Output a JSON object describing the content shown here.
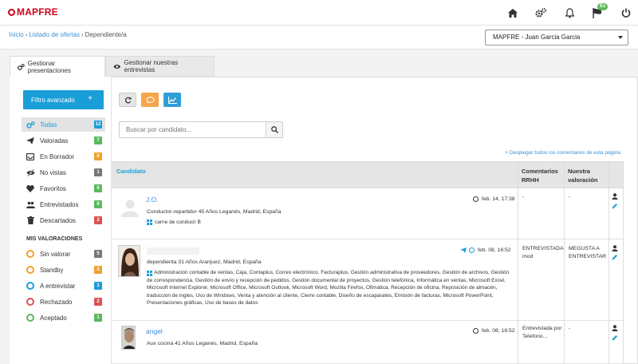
{
  "header": {
    "logo_text": "MAPFRE",
    "language_badge": "Es"
  },
  "breadcrumb": {
    "items": [
      "Inicio",
      "Listado de ofertas",
      "Dependiente/a"
    ]
  },
  "account_select": {
    "value": "MAPFRE - Juan Garcia Garcia"
  },
  "tabs": [
    {
      "label": "Gestionar presentaciones"
    },
    {
      "label": "Gestionar nuestras entrevistas"
    }
  ],
  "sidebar": {
    "filter_button": "Filtro avanzado",
    "filter_plus": "+",
    "items": [
      {
        "label": "Todas",
        "count": "12",
        "icon": "gears-icon",
        "color": "#1b9ed8"
      },
      {
        "label": "Valoradas",
        "count": "7",
        "icon": "paper-plane-icon",
        "color": "#5cb85c"
      },
      {
        "label": "En Borrador",
        "count": "0",
        "icon": "inbox-icon",
        "color": "#f0a030"
      },
      {
        "label": "No vistas",
        "count": "1",
        "icon": "eye-slash-icon",
        "color": "#777777"
      },
      {
        "label": "Favoritos",
        "count": "0",
        "icon": "heart-icon",
        "color": "#5cb85c"
      },
      {
        "label": "Entrevistados",
        "count": "0",
        "icon": "users-icon",
        "color": "#5cb85c"
      },
      {
        "label": "Descartados",
        "count": "2",
        "icon": "trash-icon",
        "color": "#d9534f"
      }
    ],
    "section_title": "MIS VALORACIONES",
    "valoraciones": [
      {
        "label": "Sin valorar",
        "count": "5",
        "ring": "#f0a030",
        "color": "#777777"
      },
      {
        "label": "Standby",
        "count": "3",
        "ring": "#f0a030",
        "color": "#f0a030"
      },
      {
        "label": "A entrevistar",
        "count": "1",
        "ring": "#1b9ed8",
        "color": "#1b9ed8"
      },
      {
        "label": "Rechazado",
        "count": "2",
        "ring": "#d9534f",
        "color": "#d9534f"
      },
      {
        "label": "Aceptado",
        "count": "1",
        "ring": "#5cb85c",
        "color": "#5cb85c"
      }
    ]
  },
  "toolbar": {
    "refresh_icon": "refresh-icon",
    "comment_icon": "comment-icon",
    "chart_icon": "line-chart-icon"
  },
  "search": {
    "placeholder": "Buscar por candidato..."
  },
  "toggle_comments_link": "+ Desplegar todos los comentarios de esta página",
  "table": {
    "headers": {
      "candidate": "Candidato",
      "comments": "Comentarios RRHH",
      "rating": "Nuestra valoración"
    },
    "rows": [
      {
        "name": "J.O.",
        "info": "Conductor-repartidor 45 Años Leganés, Madrid, España",
        "skills": "carne de conducir B",
        "date": "feb. 14, 17:38",
        "comment": "-",
        "rating": "-"
      },
      {
        "name": "",
        "info": "dependienta 31 Años Aranjuez, Madrid, España",
        "skills": "Administración contable de ventas, Caja, Contaplus, Correo electrónico, Facturaplus, Gestión administrativa de proveedores, Gestión de archivos, Gestión de correspondencia, Gestión de envío y recepción de pedidos, Gestión documental de proyectos, Gestión telefónica, Informática en ventas, Microsoft Excel, Microsoft Internet Explorer, Microsoft Office, Microsoft Outlook, Microsoft Word, Mozilla Firefox, Ofimática, Recepción de oficina, Reposición de almacén, traduccion de ingles, Uso de Windows, Venta y atención al cliente, Cierre contable, Diseño de escaparates, Emisión de facturas, Microsoft PowerPoint, Presentaciones gráficas, Uso de bases de datos",
        "date": "feb. 08, 16:52",
        "comment": "ENTREVISTADA mod",
        "rating": "MEGUSTA A ENTREVISTAR"
      },
      {
        "name": "angel",
        "info": "Aux cocina 41 Años Leganés, Madrid, España",
        "skills": "",
        "date": "feb. 08, 16:52",
        "comment": "Entrevistada por Telefono...",
        "rating": "-"
      }
    ]
  }
}
